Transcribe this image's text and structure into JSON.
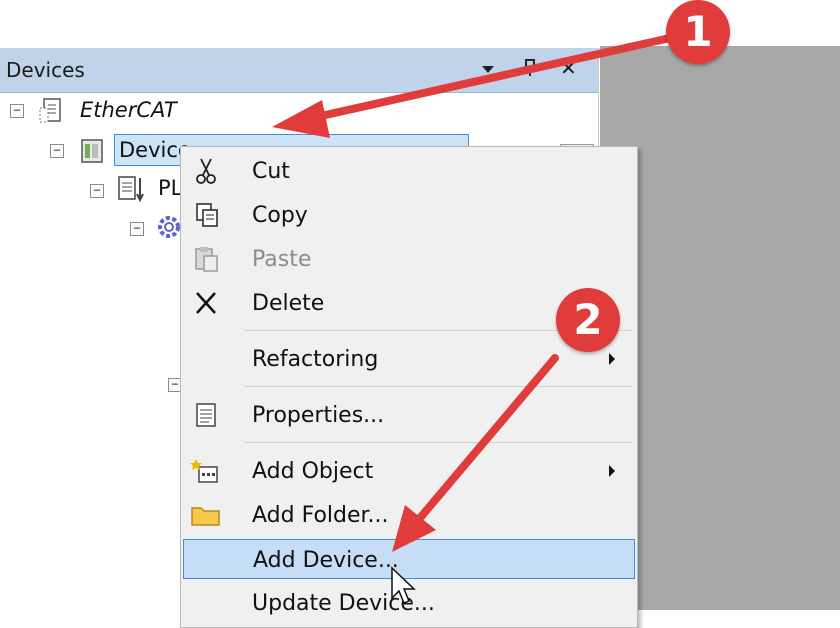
{
  "devices_panel": {
    "title": "Devices",
    "header_icons": [
      "pin-icon",
      "close-icon"
    ],
    "close_glyph": "✕"
  },
  "tree": {
    "root_label": "EtherCAT",
    "device_label": "Device",
    "plc_label": "PL"
  },
  "context_menu": {
    "items": [
      {
        "label": "Cut",
        "icon": "scissors-icon"
      },
      {
        "label": "Copy",
        "icon": "copy-icon"
      },
      {
        "label": "Paste",
        "icon": "paste-icon",
        "disabled": true
      },
      {
        "label": "Delete",
        "icon": "delete-icon"
      },
      {
        "label": "Refactoring",
        "submenu": true
      },
      {
        "label": "Properties...",
        "icon": "properties-icon"
      },
      {
        "label": "Add Object",
        "icon": "add-object-icon",
        "submenu": true
      },
      {
        "label": "Add Folder...",
        "icon": "folder-icon"
      },
      {
        "label": "Add Device...",
        "highlighted": true
      },
      {
        "label": "Update Device..."
      }
    ]
  },
  "annotations": {
    "badge_1": "1",
    "badge_2": "2",
    "color": "#e03c3c"
  }
}
